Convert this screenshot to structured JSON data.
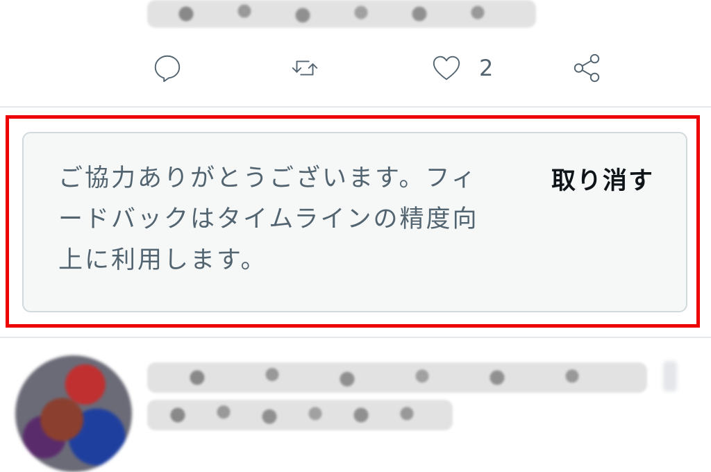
{
  "tweet_actions": {
    "reply_icon": "reply-bubble-icon",
    "retweet_icon": "retweet-icon",
    "like_icon": "heart-icon",
    "like_count": "2",
    "share_icon": "share-icon"
  },
  "feedback": {
    "message": "ご協力ありがとうございます。フィードバックはタイムラインの精度向上に利用します。",
    "undo_label": "取り消す"
  },
  "colors": {
    "icon": "#536471",
    "highlight_border": "#ee0000",
    "card_background": "#f6f8f8",
    "card_border": "#d1d9dd"
  }
}
